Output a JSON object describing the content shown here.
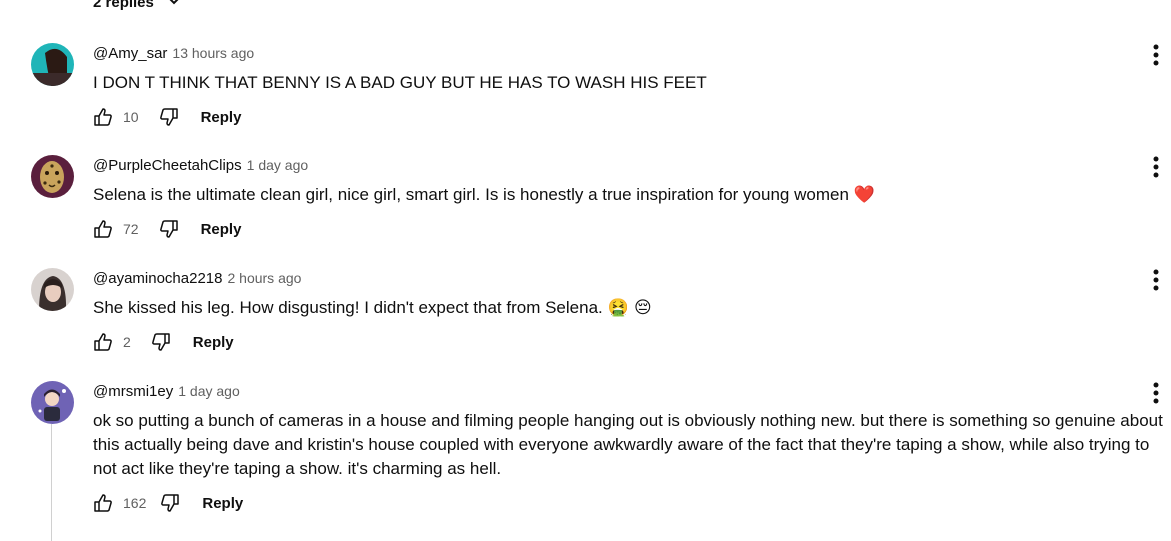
{
  "replies_toggle": {
    "label": "2 replies"
  },
  "comments": [
    {
      "author": "@Amy_sar",
      "time": "13 hours ago",
      "text": "I DON T THINK THAT BENNY IS A BAD GUY BUT HE HAS TO WASH HIS FEET",
      "likes": "10",
      "reply_label": "Reply"
    },
    {
      "author": "@PurpleCheetahClips",
      "time": "1 day ago",
      "text": "Selena is the ultimate clean girl, nice girl, smart girl. Is is honestly a true inspiration for young women",
      "emoji": "❤️",
      "likes": "72",
      "reply_label": "Reply"
    },
    {
      "author": "@ayaminocha2218",
      "time": "2 hours ago",
      "text": "She kissed his leg. How disgusting! I didn't expect that from Selena.",
      "emoji": "🤮 😔",
      "likes": "2",
      "reply_label": "Reply"
    },
    {
      "author": "@mrsmi1ey",
      "time": "1 day ago",
      "text": "ok so putting a bunch of cameras in a house and filming people hanging out is obviously nothing new. but there is something so genuine about this actually being dave and kristin's house coupled with everyone awkwardly aware of the fact that they're taping a show, while also trying to not act like they're taping a show. it's charming as hell.",
      "likes": "162",
      "reply_label": "Reply"
    }
  ],
  "colors": {
    "text": "#0f0f0f",
    "secondary": "#606060",
    "heart": "#e0245e"
  }
}
